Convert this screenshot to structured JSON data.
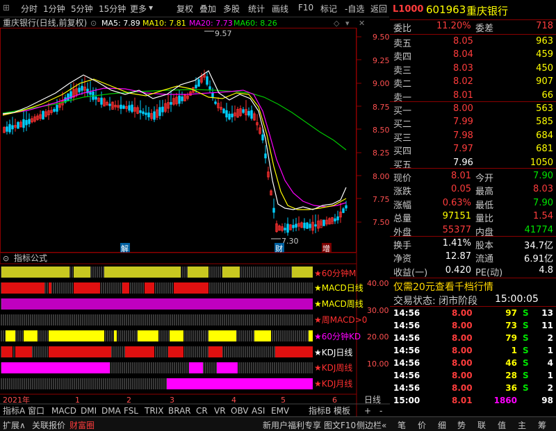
{
  "toolbar": {
    "left_tabs": [
      "分时",
      "1分钟",
      "5分钟",
      "15分钟",
      "更多"
    ],
    "right_tabs": [
      "复权",
      "叠加",
      "多股",
      "统计",
      "画线",
      "F10",
      "标记",
      "-自选",
      "返回"
    ]
  },
  "chart_header": {
    "title": "重庆银行(日线,前复权)",
    "ma5": "MA5: 7.89",
    "ma10": "MA10: 7.81",
    "ma20": "MA20: 7.73",
    "ma60": "MA60: 8.26"
  },
  "quote_header": {
    "prefix": "L1000",
    "code": "601963",
    "name": "重庆银行"
  },
  "price_axis": [
    "9.50",
    "9.25",
    "9.00",
    "8.75",
    "8.50",
    "8.25",
    "8.00",
    "7.75",
    "7.50"
  ],
  "annotations": {
    "high": "9.57",
    "low": "7.30",
    "mark1": "解",
    "mark2": "财",
    "mark3": "增"
  },
  "indicator_panel": {
    "title": "指标公式",
    "axis": [
      "40.00",
      "30.00",
      "20.00",
      "10.00"
    ],
    "rows": [
      "★60分钟M",
      "★MACD日线",
      "★MACD周线",
      "★周MACD>0",
      "★60分钟KD",
      "★KDJ日线",
      "★KDJ周线",
      "★KDJ月线"
    ]
  },
  "time_axis": {
    "year": "2021年",
    "months": [
      "1",
      "2",
      "3",
      "4",
      "5",
      "6"
    ],
    "period": "日线"
  },
  "indicator_tabs": [
    "指标A",
    "窗口",
    "MACD",
    "DMI",
    "DMA",
    "FSL",
    "TRIX",
    "BRAR",
    "CR",
    "VR",
    "OBV",
    "ASI",
    "EMV",
    "指标B",
    "模板",
    "+",
    "-"
  ],
  "commission": {
    "label1": "委比",
    "value1": "11.20%",
    "label2": "委差",
    "value2": "718"
  },
  "asks": [
    {
      "label": "卖五",
      "price": "8.05",
      "volume": "963"
    },
    {
      "label": "卖四",
      "price": "8.04",
      "volume": "459"
    },
    {
      "label": "卖三",
      "price": "8.03",
      "volume": "450"
    },
    {
      "label": "卖二",
      "price": "8.02",
      "volume": "907"
    },
    {
      "label": "卖一",
      "price": "8.01",
      "volume": "66"
    }
  ],
  "bids": [
    {
      "label": "买一",
      "price": "8.00",
      "volume": "563"
    },
    {
      "label": "买二",
      "price": "7.99",
      "volume": "585"
    },
    {
      "label": "买三",
      "price": "7.98",
      "volume": "684"
    },
    {
      "label": "买四",
      "price": "7.97",
      "volume": "681"
    },
    {
      "label": "买五",
      "price": "7.96",
      "volume": "1050"
    }
  ],
  "stats1": [
    {
      "l1": "现价",
      "v1": "8.01",
      "l2": "今开",
      "v2": "7.90"
    },
    {
      "l1": "涨跌",
      "v1": "0.05",
      "l2": "最高",
      "v2": "8.03"
    },
    {
      "l1": "涨幅",
      "v1": "0.63%",
      "l2": "最低",
      "v2": "7.90"
    },
    {
      "l1": "总量",
      "v1": "97151",
      "l2": "量比",
      "v2": "1.54"
    },
    {
      "l1": "外盘",
      "v1": "55377",
      "l2": "内盘",
      "v2": "41774"
    }
  ],
  "stats2": [
    {
      "l1": "换手",
      "v1": "1.41%",
      "l2": "股本",
      "v2": "34.7亿"
    },
    {
      "l1": "净资",
      "v1": "12.87",
      "l2": "流通",
      "v2": "6.91亿"
    },
    {
      "l1": "收益(一)",
      "v1": "0.420",
      "l2": "PE(动)",
      "v2": "4.8"
    }
  ],
  "promo": "仅需20元查看千档行情",
  "trade_status": {
    "label": "交易状态: 闭市阶段",
    "time": "15:00:05"
  },
  "ticks": [
    {
      "time": "14:56",
      "price": "8.00",
      "vol": "97",
      "dir": "S",
      "n": "13"
    },
    {
      "time": "14:56",
      "price": "8.00",
      "vol": "73",
      "dir": "S",
      "n": "11"
    },
    {
      "time": "14:56",
      "price": "8.00",
      "vol": "79",
      "dir": "S",
      "n": "2"
    },
    {
      "time": "14:56",
      "price": "8.00",
      "vol": "1",
      "dir": "S",
      "n": "1"
    },
    {
      "time": "14:56",
      "price": "8.00",
      "vol": "46",
      "dir": "S",
      "n": "4"
    },
    {
      "time": "14:56",
      "price": "8.00",
      "vol": "28",
      "dir": "S",
      "n": "1"
    },
    {
      "time": "14:56",
      "price": "8.00",
      "vol": "36",
      "dir": "S",
      "n": "2"
    },
    {
      "time": "15:00",
      "price": "8.01",
      "vol": "1860",
      "dir": "",
      "n": "98"
    }
  ],
  "bottom_bar": {
    "left": [
      "扩展∧",
      "关联报价",
      "财富圈"
    ],
    "middle": [
      "新用户福利专享",
      "图文F10",
      "侧边栏«"
    ],
    "right": [
      "笔",
      "价",
      "细",
      "势",
      "联",
      "值",
      "主",
      "筹"
    ]
  }
}
